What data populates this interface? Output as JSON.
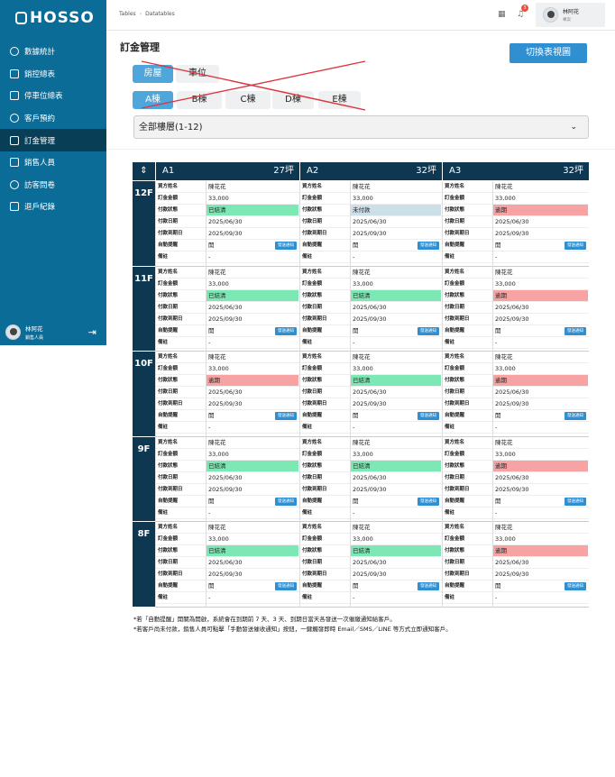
{
  "app": {
    "logo": "HOSSO"
  },
  "sidebar": {
    "items": [
      {
        "label": "數據統計",
        "icon": "clock-icon",
        "active": false
      },
      {
        "label": "銷控總表",
        "icon": "grid-icon",
        "active": false
      },
      {
        "label": "停車位總表",
        "icon": "car-icon",
        "active": false
      },
      {
        "label": "客戶預約",
        "icon": "calendar-icon",
        "active": false
      },
      {
        "label": "訂金管理",
        "icon": "user-icon",
        "active": true
      },
      {
        "label": "銷售人員",
        "icon": "person-icon",
        "active": false
      },
      {
        "label": "訪客問卷",
        "icon": "smile-icon",
        "active": false
      },
      {
        "label": "退戶紀錄",
        "icon": "user-minus-icon",
        "active": false
      }
    ],
    "user": {
      "name": "林阿花",
      "role": "銷售人員"
    }
  },
  "topbar": {
    "breadcrumb": [
      "Tables",
      "Datatables"
    ],
    "notification_count": "3",
    "user": {
      "name": "林阿花",
      "role": "專案"
    }
  },
  "page": {
    "title": "訂金管理",
    "switch_button": "切換表視圖"
  },
  "tabs_type": [
    {
      "label": "房屋",
      "active": true
    },
    {
      "label": "車位",
      "active": false
    }
  ],
  "tabs_building": [
    {
      "label": "A棟",
      "active": true
    },
    {
      "label": "B棟",
      "active": false
    },
    {
      "label": "C棟",
      "active": false
    },
    {
      "label": "D棟",
      "active": false
    },
    {
      "label": "E棟",
      "active": false
    }
  ],
  "floor_select": {
    "value": "全部樓層(1-12)"
  },
  "grid": {
    "sort_icon": "⇕",
    "units": [
      {
        "name": "A1",
        "size": "27坪"
      },
      {
        "name": "A2",
        "size": "32坪"
      },
      {
        "name": "A3",
        "size": "32坪"
      }
    ],
    "field_labels": [
      "買方姓名",
      "訂金金額",
      "付款狀態",
      "付款日期",
      "付款到期日",
      "自動提醒",
      "備註"
    ],
    "notify_label": "發送通知",
    "floors": [
      {
        "floor": "12F",
        "cells": [
          {
            "name": "陳花花",
            "amount": "33,000",
            "status": "已結清",
            "status_color": "green",
            "pay_date": "2025/06/30",
            "due_date": "2025/09/30",
            "reminder": "開",
            "note": "-"
          },
          {
            "name": "陳花花",
            "amount": "33,000",
            "status": "未付款",
            "status_color": "blue",
            "pay_date": "2025/06/30",
            "due_date": "2025/09/30",
            "reminder": "開",
            "note": "-"
          },
          {
            "name": "陳花花",
            "amount": "33,000",
            "status": "逾期",
            "status_color": "red",
            "pay_date": "2025/06/30",
            "due_date": "2025/09/30",
            "reminder": "開",
            "note": "-"
          }
        ]
      },
      {
        "floor": "11F",
        "cells": [
          {
            "name": "陳花花",
            "amount": "33,000",
            "status": "已結清",
            "status_color": "green",
            "pay_date": "2025/06/30",
            "due_date": "2025/09/30",
            "reminder": "開",
            "note": "-"
          },
          {
            "name": "陳花花",
            "amount": "33,000",
            "status": "已結清",
            "status_color": "green",
            "pay_date": "2025/06/30",
            "due_date": "2025/09/30",
            "reminder": "開",
            "note": "-"
          },
          {
            "name": "陳花花",
            "amount": "33,000",
            "status": "逾期",
            "status_color": "red",
            "pay_date": "2025/06/30",
            "due_date": "2025/09/30",
            "reminder": "開",
            "note": "-"
          }
        ]
      },
      {
        "floor": "10F",
        "cells": [
          {
            "name": "陳花花",
            "amount": "33,000",
            "status": "逾期",
            "status_color": "red",
            "pay_date": "2025/06/30",
            "due_date": "2025/09/30",
            "reminder": "開",
            "note": "-"
          },
          {
            "name": "陳花花",
            "amount": "33,000",
            "status": "已結清",
            "status_color": "green",
            "pay_date": "2025/06/30",
            "due_date": "2025/09/30",
            "reminder": "開",
            "note": "-"
          },
          {
            "name": "陳花花",
            "amount": "33,000",
            "status": "逾期",
            "status_color": "red",
            "pay_date": "2025/06/30",
            "due_date": "2025/09/30",
            "reminder": "開",
            "note": "-"
          }
        ]
      },
      {
        "floor": "9F",
        "cells": [
          {
            "name": "陳花花",
            "amount": "33,000",
            "status": "已結清",
            "status_color": "green",
            "pay_date": "2025/06/30",
            "due_date": "2025/09/30",
            "reminder": "開",
            "note": "-"
          },
          {
            "name": "陳花花",
            "amount": "33,000",
            "status": "已結清",
            "status_color": "green",
            "pay_date": "2025/06/30",
            "due_date": "2025/09/30",
            "reminder": "開",
            "note": "-"
          },
          {
            "name": "陳花花",
            "amount": "33,000",
            "status": "逾期",
            "status_color": "red",
            "pay_date": "2025/06/30",
            "due_date": "2025/09/30",
            "reminder": "開",
            "note": "-"
          }
        ]
      },
      {
        "floor": "8F",
        "cells": [
          {
            "name": "陳花花",
            "amount": "33,000",
            "status": "已結清",
            "status_color": "green",
            "pay_date": "2025/06/30",
            "due_date": "2025/09/30",
            "reminder": "開",
            "note": "-"
          },
          {
            "name": "陳花花",
            "amount": "33,000",
            "status": "已結清",
            "status_color": "green",
            "pay_date": "2025/06/30",
            "due_date": "2025/09/30",
            "reminder": "開",
            "note": "-"
          },
          {
            "name": "陳花花",
            "amount": "33,000",
            "status": "逾期",
            "status_color": "red",
            "pay_date": "2025/06/30",
            "due_date": "2025/09/30",
            "reminder": "開",
            "note": "-"
          }
        ]
      }
    ]
  },
  "notes": [
    "*若「自動提醒」開關為開啟，系統會在到期前 7 天、3 天、到期日當天各發送一次催繳通知給客戶。",
    "*若客戶尚未付款，銷售人員可點擊「手動發送催收通知」按鈕，一鍵觸發即時 Email／SMS／LINE 等方式立即通知客戶。"
  ],
  "colors": {
    "sidebar": "#0c6c98",
    "sidebar_active": "#093e57",
    "header": "#0e3752",
    "accent": "#2f8fd1",
    "paid": "#7de8b5",
    "overdue": "#f7a3a3",
    "unpaid": "#cde0ea"
  }
}
